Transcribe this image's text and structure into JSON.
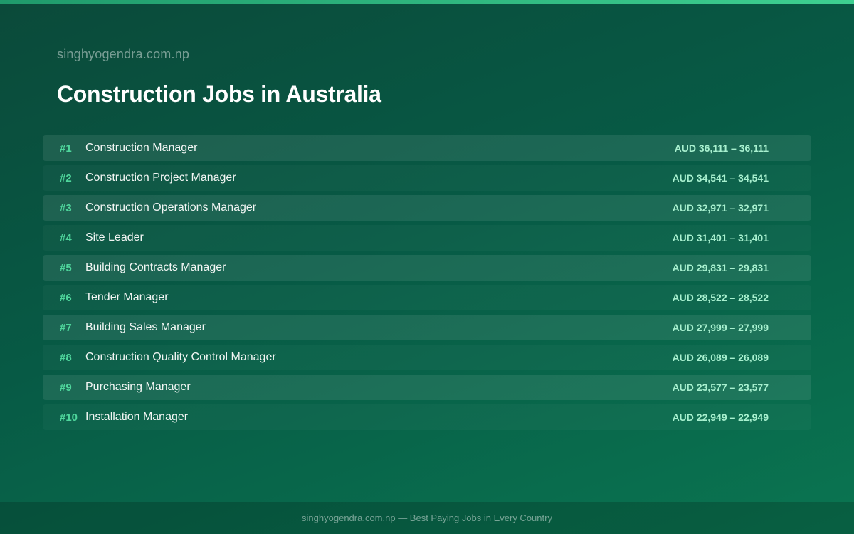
{
  "header": {
    "site_name": "singhyogendra.com.np",
    "title": "Construction Jobs in Australia"
  },
  "jobs": [
    {
      "rank": "#1",
      "title": "Construction Manager",
      "salary": "AUD 36,111 – 36,111"
    },
    {
      "rank": "#2",
      "title": "Construction Project Manager",
      "salary": "AUD 34,541 – 34,541"
    },
    {
      "rank": "#3",
      "title": "Construction Operations Manager",
      "salary": "AUD 32,971 – 32,971"
    },
    {
      "rank": "#4",
      "title": "Site Leader",
      "salary": "AUD 31,401 – 31,401"
    },
    {
      "rank": "#5",
      "title": "Building Contracts Manager",
      "salary": "AUD 29,831 – 29,831"
    },
    {
      "rank": "#6",
      "title": "Tender Manager",
      "salary": "AUD 28,522 – 28,522"
    },
    {
      "rank": "#7",
      "title": "Building Sales Manager",
      "salary": "AUD 27,999 – 27,999"
    },
    {
      "rank": "#8",
      "title": "Construction Quality Control Manager",
      "salary": "AUD 26,089 – 26,089"
    },
    {
      "rank": "#9",
      "title": "Purchasing Manager",
      "salary": "AUD 23,577 – 23,577"
    },
    {
      "rank": "#10",
      "title": "Installation Manager",
      "salary": "AUD 22,949 – 22,949"
    }
  ],
  "footer": {
    "text": "singhyogendra.com.np — Best Paying Jobs in Every Country"
  },
  "colors": {
    "accent": "#4fd69c",
    "salary": "#a8f0cf",
    "background_start": "#0b4a3a",
    "background_end": "#0a7551"
  }
}
